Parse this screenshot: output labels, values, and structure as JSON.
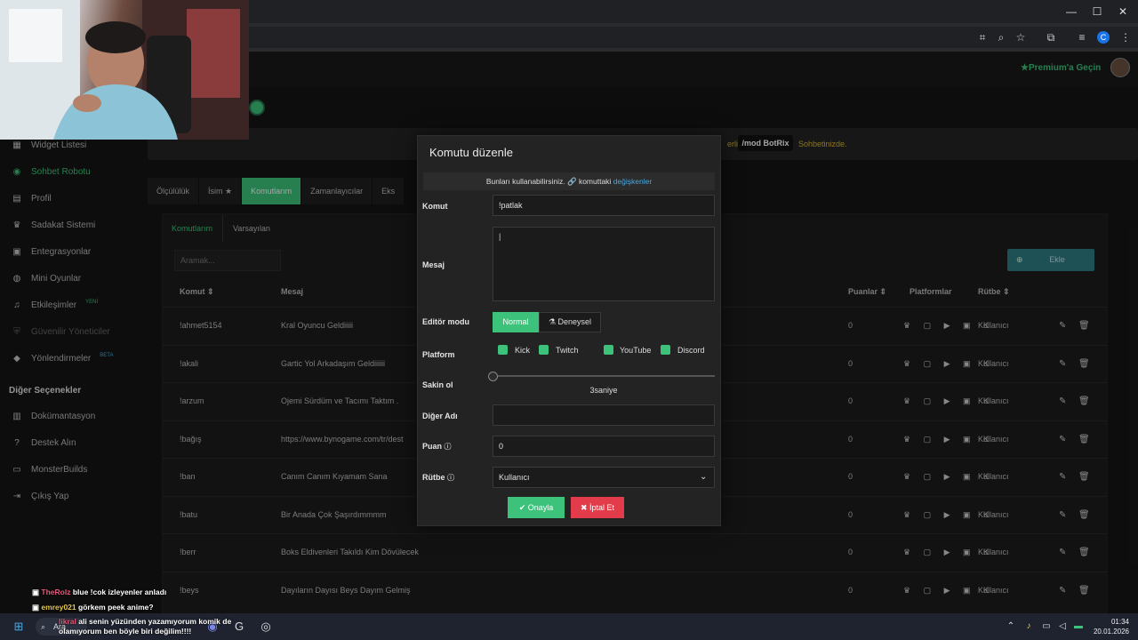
{
  "browser": {
    "window_buttons": [
      "—",
      "☐",
      "✕"
    ],
    "toolbar_icons": [
      "translate-icon",
      "zoom-icon",
      "star-icon",
      "extensions-icon",
      "media-icon",
      "profile-icon",
      "menu-icon"
    ],
    "profile_letter": "C"
  },
  "header": {
    "premium": "Premium'a Geçin"
  },
  "sidebar": {
    "items": [
      {
        "label": "Widget Listesi",
        "icon": "grid-icon",
        "glyph": "▦"
      },
      {
        "label": "Sohbet Robotu",
        "icon": "robot-icon",
        "glyph": "◉"
      },
      {
        "label": "Profil",
        "icon": "id-card-icon",
        "glyph": "▤"
      },
      {
        "label": "Sadakat Sistemi",
        "icon": "trophy-icon",
        "glyph": "♛"
      },
      {
        "label": "Entegrasyonlar",
        "icon": "plug-icon",
        "glyph": "▣"
      },
      {
        "label": "Mini Oyunlar",
        "icon": "gamepad-icon",
        "glyph": "◍"
      },
      {
        "label": "Etkileşimler",
        "icon": "music-icon",
        "glyph": "♫",
        "tag": "YENİ"
      },
      {
        "label": "Güvenilir Yöneticiler",
        "icon": "shield-icon",
        "glyph": "⛨"
      },
      {
        "label": "Yönlendirmeler",
        "icon": "users-icon",
        "glyph": "◆",
        "tag": "BETA"
      }
    ],
    "section_title": "Diğer Seçenekler",
    "other_items": [
      {
        "label": "Dokümantasyon",
        "icon": "book-icon",
        "glyph": "▥"
      },
      {
        "label": "Destek Alın",
        "icon": "help-icon",
        "glyph": "?"
      },
      {
        "label": "MonsterBuilds",
        "icon": "monitor-icon",
        "glyph": "▭"
      },
      {
        "label": "Çıkış Yap",
        "icon": "logout-icon",
        "glyph": "⇥"
      }
    ]
  },
  "banner": {
    "text": "erli.",
    "command": "/mod BotRix",
    "after": "Sohbetinizde."
  },
  "tabs": [
    "Ölçülülük",
    "İsim ★",
    "Komutlarım",
    "Zamanlayıcılar",
    "Eks"
  ],
  "subtabs": [
    "Komutlarım",
    "Varsayılan"
  ],
  "search": {
    "placeholder": "Aramak..."
  },
  "add_button": {
    "label": "Ekle"
  },
  "table": {
    "headers": {
      "command": "Komut ⇕",
      "message": "Mesaj",
      "points": "Puanlar ⇕",
      "platforms": "Platformlar",
      "rank": "Rütbe ⇕"
    },
    "rows": [
      {
        "command": "!ahmet5154",
        "message": "Kral Oyuncu Geldiiiii",
        "points": "0",
        "rank": "Kullanıcı"
      },
      {
        "command": "!akali",
        "message": "Gartic Yol Arkadaşım Geldiiiiii",
        "points": "0",
        "rank": "Kullanıcı"
      },
      {
        "command": "!arzum",
        "message": "Ojemi Sürdüm ve Tacımı Taktım .",
        "points": "0",
        "rank": "Kullanıcı"
      },
      {
        "command": "!bağış",
        "message": "https://www.bynogame.com/tr/dest",
        "points": "0",
        "rank": "Kullanıcı"
      },
      {
        "command": "!ban",
        "message": "Canım Canım Kıyamam Sana",
        "points": "0",
        "rank": "Kullanıcı"
      },
      {
        "command": "!batu",
        "message": "Bir Anada Çok Şaşırdımmmm",
        "points": "0",
        "rank": "Kullanıcı"
      },
      {
        "command": "!berr",
        "message": "Boks Eldivenleri Takıldı Kim Dövülecek",
        "points": "0",
        "rank": "Kullanıcı"
      },
      {
        "command": "!beys",
        "message": "Dayıların Dayısı Beys Dayım Gelmiş",
        "points": "0",
        "rank": "Kullanıcı"
      }
    ],
    "platform_glyphs": "♛ ▢ ▶ ▣ K",
    "action_edit": "✎",
    "action_delete": "🗑"
  },
  "modal": {
    "title": "Komutu düzenle",
    "info": "Bunları kullanabilirsiniz. 🔗 komuttaki",
    "info_link": "değişkenler",
    "labels": {
      "command": "Komut",
      "message": "Mesaj",
      "editor_mode": "Editör modu",
      "platform": "Platform",
      "cooldown": "Sakin ol",
      "alias": "Diğer Adı",
      "points": "Puan",
      "rank": "Rütbe"
    },
    "values": {
      "command": "!patlak",
      "message": "",
      "alias": "",
      "points": "0",
      "rank": "Kullanıcı"
    },
    "editor_modes": {
      "normal": "Normal",
      "experimental": "Deneysel"
    },
    "platforms": [
      "Kick",
      "Twitch",
      "YouTube",
      "Discord"
    ],
    "cooldown_value": "3saniye",
    "cooldown_fraction": 0,
    "confirm": "Onayla",
    "cancel": "İptal Et"
  },
  "chat": [
    {
      "name": "TheRolz",
      "text": "blue !cok izleyenler anladı"
    },
    {
      "name": "emrey021",
      "text": "görkem peek anime?"
    },
    {
      "name": "likral",
      "text": "ali senin yüzünden yazamıyorum komik de olamıyorum ben böyle biri değilim!!!!"
    }
  ],
  "taskbar": {
    "search": "Ara",
    "time": "01:34",
    "date": "20.01.2026"
  },
  "colors": {
    "accent": "#3cc27a",
    "danger": "#e23b4a",
    "link": "#4aa8e0",
    "banner": "#d8b536"
  }
}
